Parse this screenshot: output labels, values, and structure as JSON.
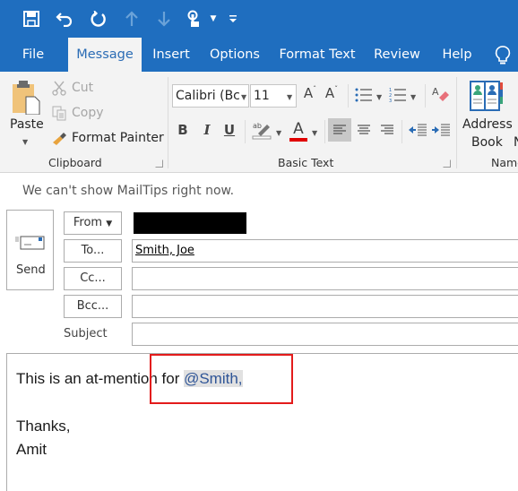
{
  "quick_access": {
    "icons": [
      "save-icon",
      "undo-icon",
      "redo-icon",
      "previous-item-icon",
      "next-item-icon",
      "touch-mode-icon",
      "customize-toolbar-icon"
    ]
  },
  "tabs": [
    {
      "label": "File",
      "active": false
    },
    {
      "label": "Message",
      "active": true
    },
    {
      "label": "Insert",
      "active": false
    },
    {
      "label": "Options",
      "active": false
    },
    {
      "label": "Format Text",
      "active": false
    },
    {
      "label": "Review",
      "active": false
    },
    {
      "label": "Help",
      "active": false
    }
  ],
  "tell_me_icon": "lightbulb-icon",
  "ribbon": {
    "clipboard": {
      "paste": "Paste",
      "cut": "Cut",
      "copy": "Copy",
      "format_painter": "Format Painter",
      "group_label": "Clipboard"
    },
    "basic_text": {
      "font_name": "Calibri (Bc",
      "font_size": "11",
      "bold": "B",
      "italic": "I",
      "underline": "U",
      "font_color_accent": "#e00000",
      "group_label": "Basic Text"
    },
    "names": {
      "address_book_line1": "Address",
      "address_book_line2": "Book",
      "check_names_partial": "N",
      "group_label": "Name"
    }
  },
  "mailtips": "We can't show MailTips right now.",
  "compose": {
    "send_label": "Send",
    "from_label": "From",
    "from_value_redacted": true,
    "to_label": "To...",
    "to_value": "Smith, Joe",
    "cc_label": "Cc...",
    "cc_value": "",
    "bcc_label": "Bcc...",
    "bcc_value": "",
    "subject_label": "Subject",
    "subject_value": ""
  },
  "body": {
    "line1_text": "This is an at-mention for ",
    "mention": "@Smith,",
    "line2": "Thanks,",
    "line3": "Amit"
  },
  "colors": {
    "brand_blue": "#1f6ebf",
    "mention_text": "#2f5597",
    "highlight_box": "#e31b1b"
  }
}
